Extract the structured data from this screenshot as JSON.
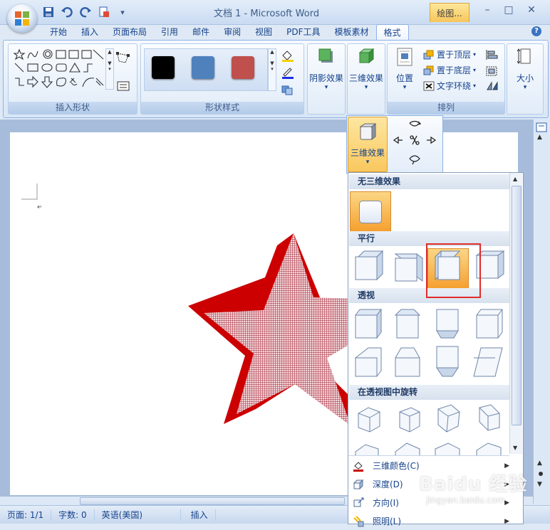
{
  "title_bar": {
    "document_title": "文档 1 - Microsoft Word",
    "contextual_tab": "绘图...",
    "minimize": "–",
    "restore": "□",
    "close": "✕"
  },
  "quick_access": {
    "save_icon": "save-icon",
    "undo_icon": "undo-icon",
    "redo_icon": "redo-icon",
    "print_preview_icon": "print-preview-icon",
    "customize": "▾"
  },
  "tabs": [
    "开始",
    "插入",
    "页面布局",
    "引用",
    "邮件",
    "审阅",
    "视图",
    "PDF工具",
    "模板素材",
    "格式"
  ],
  "active_tab": "格式",
  "help": "?",
  "ribbon": {
    "insert_shapes_label": "插入形状",
    "shape_styles_label": "形状样式",
    "style_swatches": [
      "#000000",
      "#4f81bd",
      "#c0504d"
    ],
    "shadow_effects": "阴影效果",
    "effects_3d": "三维效果",
    "arrange_label": "排列",
    "position": "位置",
    "bring_to_front": "置于顶层",
    "send_to_back": "置于底层",
    "text_wrap": "文字环绕",
    "size": "大小"
  },
  "popup": {
    "button_3d": "三维效果",
    "sections": {
      "none": "无三维效果",
      "parallel": "平行",
      "perspective": "透视",
      "rotation": "在透视图中旋转"
    },
    "menu": [
      {
        "label": "三维颜色(C)",
        "icon": "3d-color-icon"
      },
      {
        "label": "深度(D)",
        "icon": "depth-icon"
      },
      {
        "label": "方向(I)",
        "icon": "direction-icon"
      },
      {
        "label": "照明(L)",
        "icon": "lighting-icon"
      }
    ]
  },
  "status_bar": {
    "page": "页面: 1/1",
    "words": "字数: 0",
    "language": "英语(美国)",
    "mode": "插入"
  },
  "star_colors": {
    "fill": "#b5474f",
    "extrusion": "#cc0000"
  },
  "watermark": {
    "text": "Baidu 经验",
    "sub": "jingyan.baidu.com"
  }
}
